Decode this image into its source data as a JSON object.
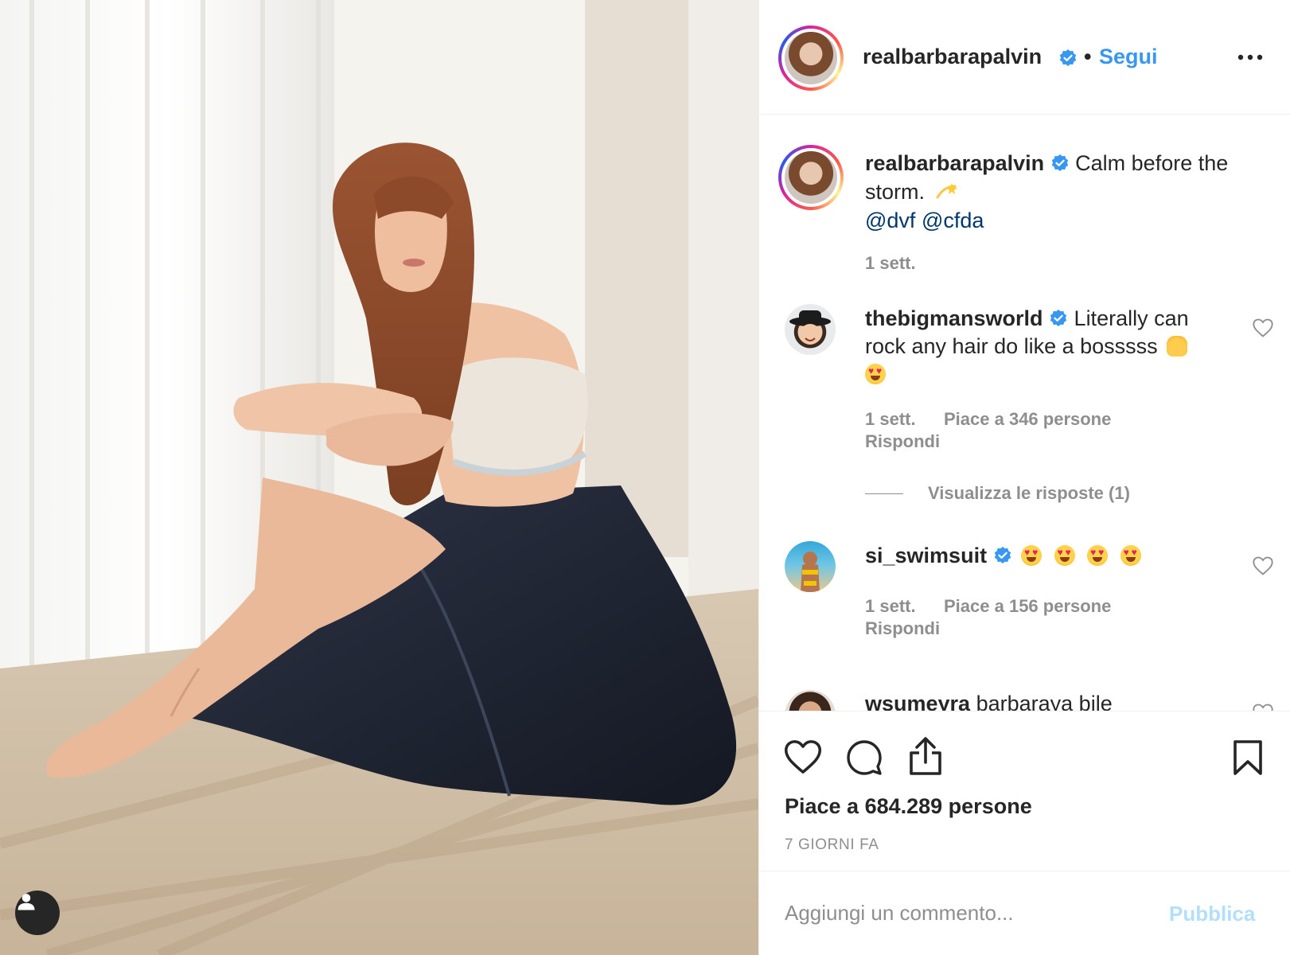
{
  "header": {
    "username": "realbarbarapalvin",
    "separator": "•",
    "follow_label": "Segui"
  },
  "caption": {
    "username": "realbarbarapalvin",
    "text": "Calm before the storm.",
    "mention_1": "@dvf",
    "mention_2": "@cfda",
    "time": "1 sett."
  },
  "comments": [
    {
      "username": "thebigmansworld",
      "text_line": "Literally can rock any hair do like a bosssss",
      "time": "1 sett.",
      "likes": "Piace a 346 persone",
      "reply": "Rispondi",
      "view_replies": "Visualizza le risposte (1)"
    },
    {
      "username": "si_swimsuit",
      "time": "1 sett.",
      "likes": "Piace a 156 persone",
      "reply": "Rispondi"
    },
    {
      "username": "wsumeyra",
      "text_line": "barbaraya bile"
    }
  ],
  "post": {
    "likes": "Piace a 684.289 persone",
    "ago": "7 GIORNI FA"
  },
  "add_comment": {
    "placeholder": "Aggiungi un commento...",
    "publish_label": "Pubblica"
  },
  "colors": {
    "link_blue": "#3897f0",
    "mention_blue": "#00376b",
    "muted": "#8e8e8e",
    "publish_disabled": "#b2dffc"
  },
  "icons": [
    "verified-badge-icon",
    "more-options-icon",
    "heart-icon",
    "comment-icon",
    "share-icon",
    "bookmark-icon",
    "user-tag-icon"
  ]
}
